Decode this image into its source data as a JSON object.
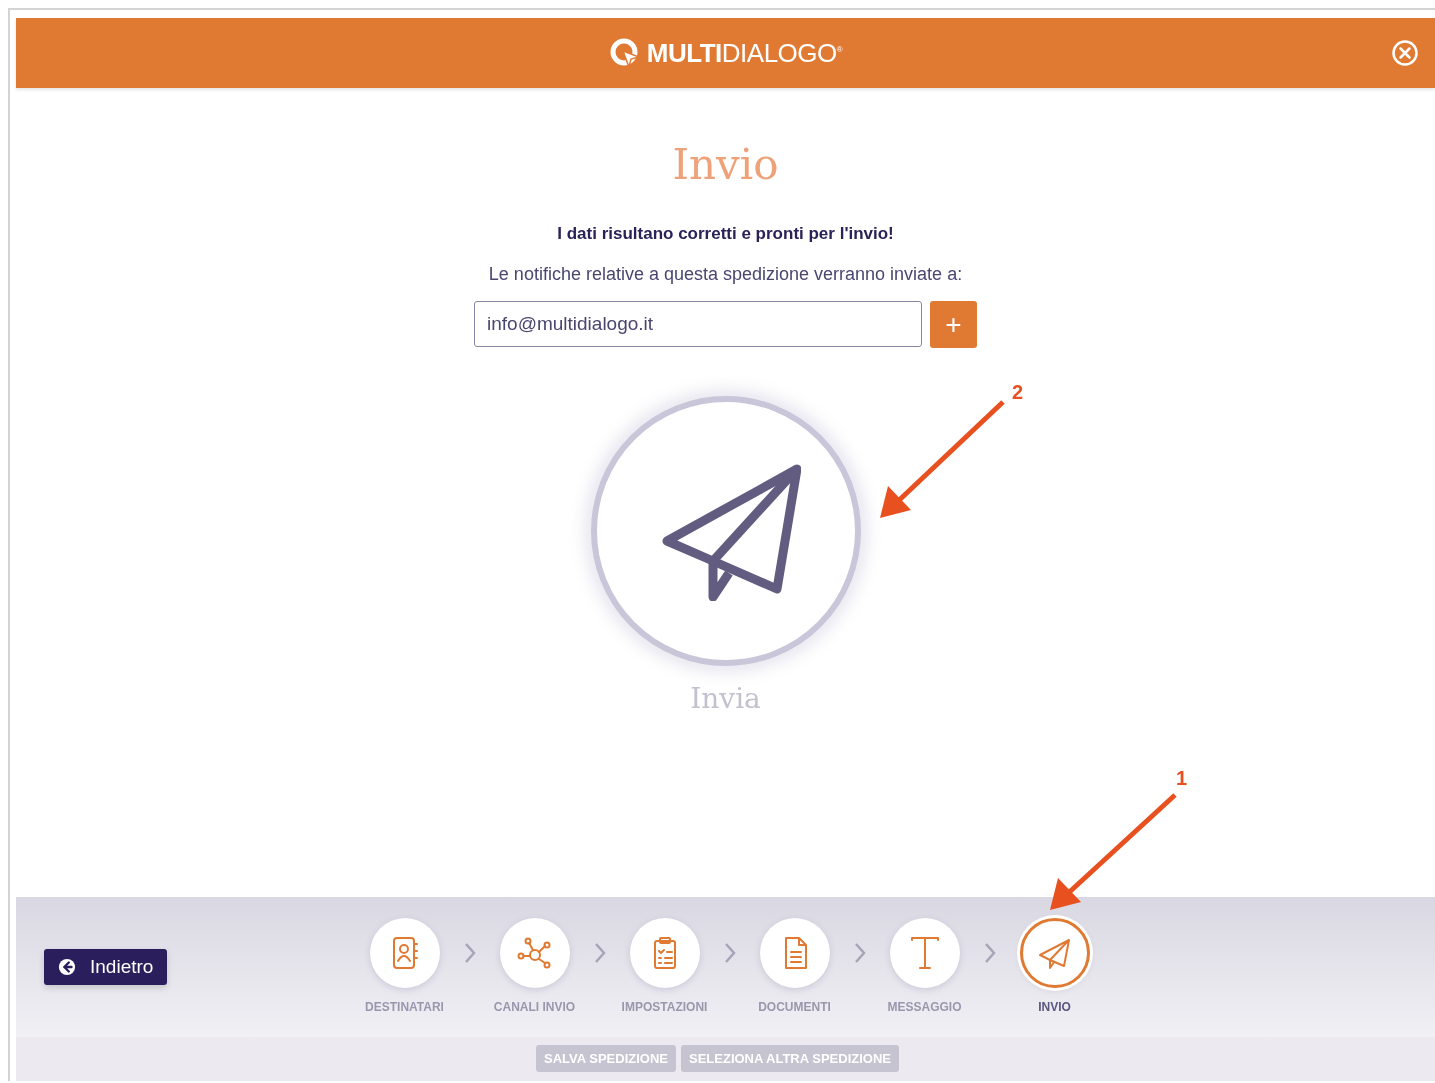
{
  "header": {
    "logo": "**MULTI**DIALOGO$^{®}$"
  },
  "title": "Invio",
  "confirmation": "I dati risultano corretti e pronti per l'invio!",
  "notice": "Le notifiche relative a questa spedizione verranno inviate a:",
  "email_field": {
    "value": "info@multidialogo.it"
  },
  "add_button": "+",
  "send_button": {
    "label": "Invia"
  },
  "back_button": "Indietro",
  "steps": [
    {
      "label": "DESTINATARI",
      "kind": "contacts",
      "selected": false
    },
    {
      "label": "CANALI INVIO",
      "kind": "network",
      "selected": false
    },
    {
      "label": "IMPOSTAZIONI",
      "kind": "clipboard",
      "selected": false
    },
    {
      "label": "DOCUMENTI",
      "kind": "document",
      "selected": false
    },
    {
      "label": "MESSAGGIO",
      "kind": "text",
      "selected": false
    },
    {
      "label": "INVIO",
      "kind": "send",
      "selected": true
    }
  ],
  "footer_buttons": [
    "SALVA SPEDIZIONE",
    "SELEZIONA ALTRA SPEDIZIONE"
  ],
  "annotations": [
    {
      "label": "2"
    },
    {
      "label": "1"
    }
  ]
}
